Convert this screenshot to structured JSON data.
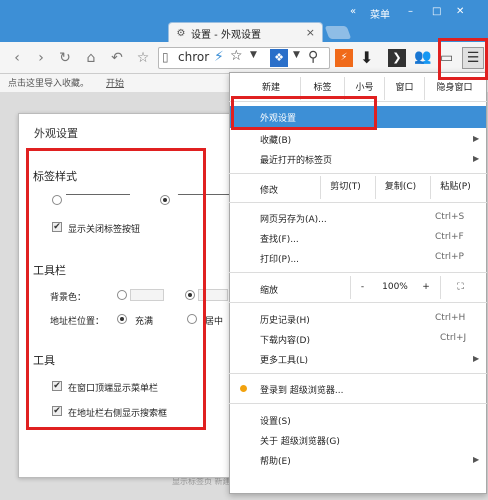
{
  "browser": {
    "tab_title": "设置 - 外观设置",
    "close_glyph": "×",
    "winctl": {
      "scroll": "«",
      "menu": "菜单",
      "minimize": "–",
      "maximize": "□",
      "close": "✕"
    },
    "url": "chror",
    "bookmark_bar": {
      "import_text": "点击这里导入收藏。",
      "start_link": "开始"
    }
  },
  "dialog": {
    "title": "外观设置",
    "tab_style": {
      "title": "标签样式",
      "show_close": "显示关闭标签按钮"
    },
    "toolbar_section": {
      "title": "工具栏",
      "bg_color_label": "背景色：",
      "address_pos_label": "地址栏位置：",
      "option_full": "充满",
      "option_center": "居中"
    },
    "tools_section": {
      "title": "工具",
      "menu_bar_label": "在窗口顶端显示菜单栏",
      "search_box_label": "在地址栏右侧显示搜索框"
    },
    "bottom_hidden": "显示标签页 新建标签 显示用户"
  },
  "menu": {
    "top_buttons": [
      "新建",
      "标签",
      "小号",
      "窗口",
      "隐身窗口"
    ],
    "appearance": "外观设置",
    "favorites": "收藏(B)",
    "recent_tabs": "最近打开的标签页",
    "edit_label": "修改",
    "cut": "剪切(T)",
    "copy": "复制(C)",
    "paste": "粘贴(P)",
    "save_as": "网页另存为(A)...",
    "save_as_sc": "Ctrl+S",
    "find": "查找(F)...",
    "find_sc": "Ctrl+F",
    "print": "打印(P)...",
    "print_sc": "Ctrl+P",
    "zoom_label": "缩放",
    "zoom_minus": "-",
    "zoom_value": "100%",
    "zoom_plus": "+",
    "history": "历史记录(H)",
    "history_sc": "Ctrl+H",
    "downloads": "下载内容(D)",
    "downloads_sc": "Ctrl+J",
    "more_tools": "更多工具(L)",
    "login": "登录到 超级浏览器...",
    "settings": "设置(S)",
    "about": "关于 超级浏览器(G)",
    "help": "帮助(E)"
  },
  "colors": {
    "accent": "#3d8fd6",
    "highlight_box": "#e02020",
    "menu_highlight": "#3d8fd6"
  }
}
